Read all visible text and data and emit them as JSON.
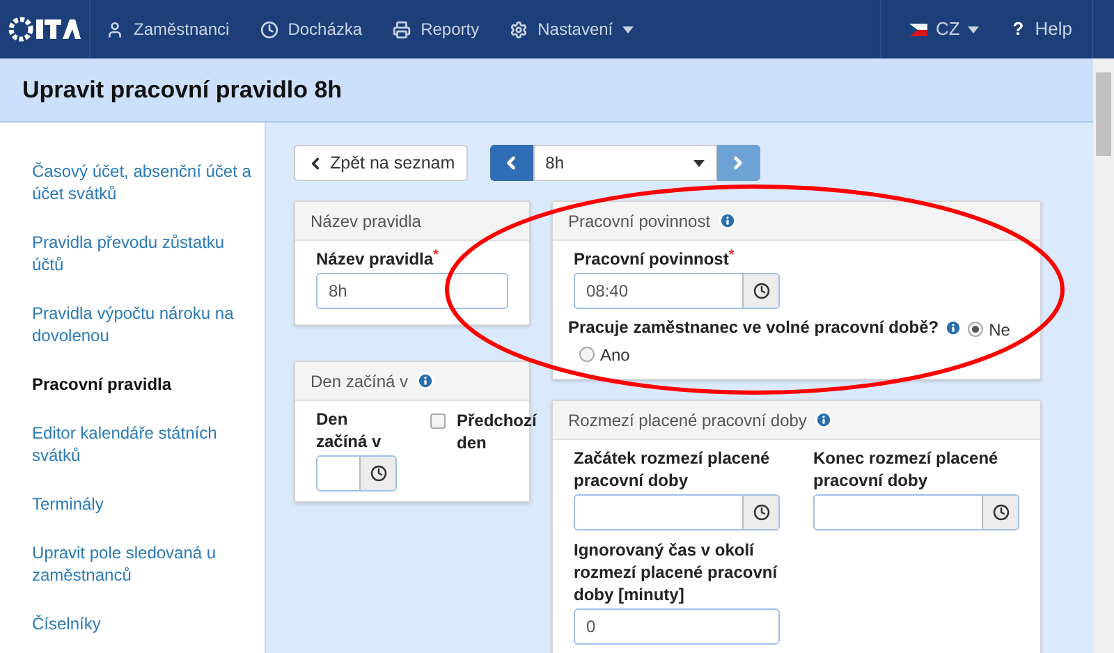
{
  "navbar": {
    "items": [
      {
        "label": "Zaměstnanci",
        "dropdown": false
      },
      {
        "label": "Docházka",
        "dropdown": false
      },
      {
        "label": "Reporty",
        "dropdown": false
      },
      {
        "label": "Nastavení",
        "dropdown": true
      }
    ],
    "language": "CZ",
    "help": {
      "icon": "?",
      "label": "Help"
    }
  },
  "page_title": "Upravit pracovní pravidlo 8h",
  "sidebar": {
    "items": [
      {
        "label": "Časový účet, absenční účet a účet svátků",
        "selected": false
      },
      {
        "label": "Pravidla převodu zůstatku účtů",
        "selected": false
      },
      {
        "label": "Pravidla výpočtu nároku na dovolenou",
        "selected": false
      },
      {
        "label": "Pracovní pravidla",
        "selected": true
      },
      {
        "label": "Editor kalendáře státních svátků",
        "selected": false
      },
      {
        "label": "Terminály",
        "selected": false
      },
      {
        "label": "Upravit pole sledovaná u zaměstnanců",
        "selected": false
      },
      {
        "label": "Číselníky",
        "selected": false
      }
    ]
  },
  "toolbar": {
    "back": "Zpět na seznam",
    "rule_select": "8h",
    "prev_disabled": false,
    "next_disabled": true
  },
  "panels": {
    "left": [
      {
        "title": "Název pravidla",
        "info": false,
        "fields": [
          {
            "kind": "text",
            "label": "Název pravidla",
            "required_mark": "*",
            "value": "8h"
          }
        ]
      },
      {
        "title": "Den začíná v",
        "info": true,
        "fields": [
          {
            "kind": "time_with_checkbox",
            "label": "Den začíná v",
            "checkbox": {
              "label": "Předchozí den",
              "checked": false
            }
          }
        ]
      }
    ],
    "right": [
      {
        "title": "Pracovní povinnost",
        "info": true,
        "fields": [
          {
            "kind": "time",
            "label": "Pracovní povinnost",
            "required_mark": "*",
            "value": "08:40"
          },
          {
            "kind": "radio",
            "label": "Pracuje zaměstnanec ve volné pracovní době?",
            "options": [
              {
                "label": "Ne",
                "selected": true
              },
              {
                "label": "Ano",
                "selected": false
              }
            ]
          }
        ]
      },
      {
        "title": "Rozmezí placené pracovní doby",
        "info": true,
        "fields": [
          {
            "kind": "time_pair",
            "items": [
              {
                "label": "Začátek rozmezí placené pracovní doby"
              },
              {
                "label": "Konec rozmezí placené pracovní doby"
              }
            ]
          },
          {
            "kind": "text",
            "label": "Ignorovaný čas v okolí rozmezí placené pracovní doby [minuty]",
            "value": "0"
          }
        ]
      }
    ]
  },
  "annotation": {
    "kind": "ellipse",
    "color": "#ff0000"
  }
}
